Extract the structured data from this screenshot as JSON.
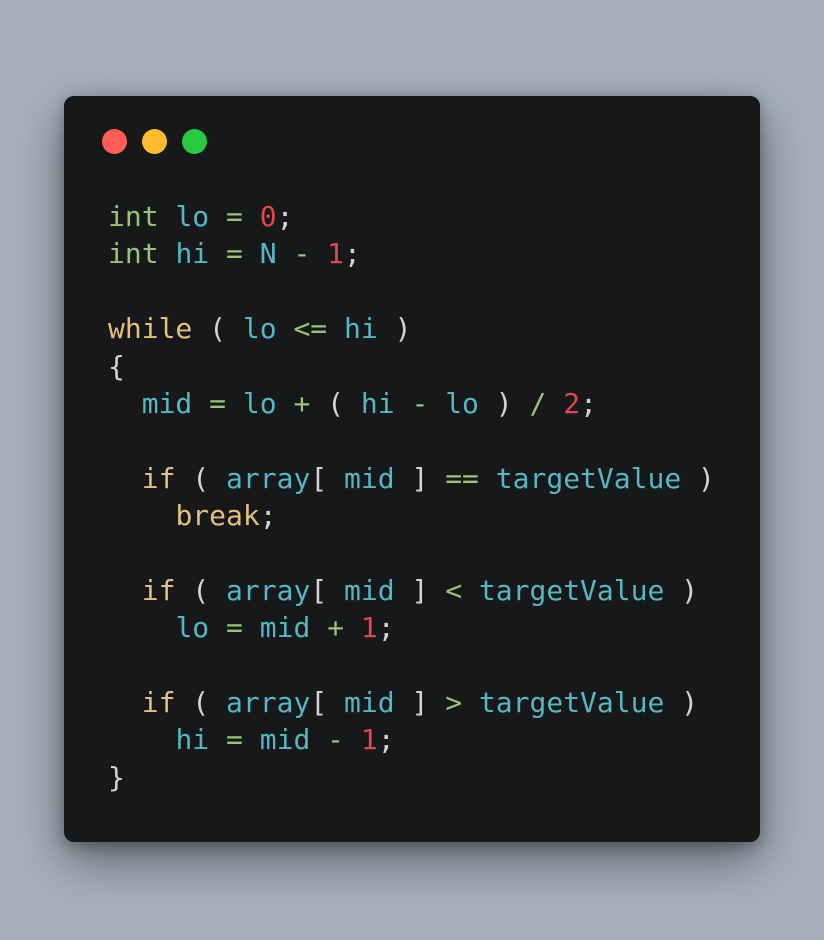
{
  "colors": {
    "background": "#a5b0bc",
    "window": "#17181a",
    "close": "#ff5f57",
    "minimize": "#febc2e",
    "maximize": "#28c840",
    "type": "#98c379",
    "keyword": "#e5c07b",
    "identifier": "#56b6c2",
    "operator": "#98c379",
    "number": "#e0484f",
    "punct": "#d4d4d4"
  },
  "window_controls": [
    {
      "name": "close-button",
      "color": "#ff5f57"
    },
    {
      "name": "minimize-button",
      "color": "#febc2e"
    },
    {
      "name": "maximize-button",
      "color": "#28c840"
    }
  ],
  "code_lines": [
    [
      {
        "t": "int",
        "c": "type"
      },
      {
        "t": " ",
        "c": "punct"
      },
      {
        "t": "lo",
        "c": "identifier"
      },
      {
        "t": " ",
        "c": "punct"
      },
      {
        "t": "=",
        "c": "operator"
      },
      {
        "t": " ",
        "c": "punct"
      },
      {
        "t": "0",
        "c": "number"
      },
      {
        "t": ";",
        "c": "punct"
      }
    ],
    [
      {
        "t": "int",
        "c": "type"
      },
      {
        "t": " ",
        "c": "punct"
      },
      {
        "t": "hi",
        "c": "identifier"
      },
      {
        "t": " ",
        "c": "punct"
      },
      {
        "t": "=",
        "c": "operator"
      },
      {
        "t": " ",
        "c": "punct"
      },
      {
        "t": "N",
        "c": "identifier"
      },
      {
        "t": " ",
        "c": "punct"
      },
      {
        "t": "-",
        "c": "operator"
      },
      {
        "t": " ",
        "c": "punct"
      },
      {
        "t": "1",
        "c": "number"
      },
      {
        "t": ";",
        "c": "punct"
      }
    ],
    [],
    [
      {
        "t": "while",
        "c": "keyword"
      },
      {
        "t": " ( ",
        "c": "punct"
      },
      {
        "t": "lo",
        "c": "identifier"
      },
      {
        "t": " ",
        "c": "punct"
      },
      {
        "t": "<=",
        "c": "operator"
      },
      {
        "t": " ",
        "c": "punct"
      },
      {
        "t": "hi",
        "c": "identifier"
      },
      {
        "t": " )",
        "c": "punct"
      }
    ],
    [
      {
        "t": "{",
        "c": "punct"
      }
    ],
    [
      {
        "t": "  ",
        "c": "punct"
      },
      {
        "t": "mid",
        "c": "identifier"
      },
      {
        "t": " ",
        "c": "punct"
      },
      {
        "t": "=",
        "c": "operator"
      },
      {
        "t": " ",
        "c": "punct"
      },
      {
        "t": "lo",
        "c": "identifier"
      },
      {
        "t": " ",
        "c": "punct"
      },
      {
        "t": "+",
        "c": "operator"
      },
      {
        "t": " ( ",
        "c": "punct"
      },
      {
        "t": "hi",
        "c": "identifier"
      },
      {
        "t": " ",
        "c": "punct"
      },
      {
        "t": "-",
        "c": "operator"
      },
      {
        "t": " ",
        "c": "punct"
      },
      {
        "t": "lo",
        "c": "identifier"
      },
      {
        "t": " ) ",
        "c": "punct"
      },
      {
        "t": "/",
        "c": "operator"
      },
      {
        "t": " ",
        "c": "punct"
      },
      {
        "t": "2",
        "c": "number"
      },
      {
        "t": ";",
        "c": "punct"
      }
    ],
    [],
    [
      {
        "t": "  ",
        "c": "punct"
      },
      {
        "t": "if",
        "c": "keyword"
      },
      {
        "t": " ( ",
        "c": "punct"
      },
      {
        "t": "array",
        "c": "identifier"
      },
      {
        "t": "[ ",
        "c": "punct"
      },
      {
        "t": "mid",
        "c": "identifier"
      },
      {
        "t": " ] ",
        "c": "punct"
      },
      {
        "t": "==",
        "c": "operator"
      },
      {
        "t": " ",
        "c": "punct"
      },
      {
        "t": "targetValue",
        "c": "identifier"
      },
      {
        "t": " )",
        "c": "punct"
      }
    ],
    [
      {
        "t": "    ",
        "c": "punct"
      },
      {
        "t": "break",
        "c": "keyword"
      },
      {
        "t": ";",
        "c": "punct"
      }
    ],
    [],
    [
      {
        "t": "  ",
        "c": "punct"
      },
      {
        "t": "if",
        "c": "keyword"
      },
      {
        "t": " ( ",
        "c": "punct"
      },
      {
        "t": "array",
        "c": "identifier"
      },
      {
        "t": "[ ",
        "c": "punct"
      },
      {
        "t": "mid",
        "c": "identifier"
      },
      {
        "t": " ] ",
        "c": "punct"
      },
      {
        "t": "<",
        "c": "operator"
      },
      {
        "t": " ",
        "c": "punct"
      },
      {
        "t": "targetValue",
        "c": "identifier"
      },
      {
        "t": " )",
        "c": "punct"
      }
    ],
    [
      {
        "t": "    ",
        "c": "punct"
      },
      {
        "t": "lo",
        "c": "identifier"
      },
      {
        "t": " ",
        "c": "punct"
      },
      {
        "t": "=",
        "c": "operator"
      },
      {
        "t": " ",
        "c": "punct"
      },
      {
        "t": "mid",
        "c": "identifier"
      },
      {
        "t": " ",
        "c": "punct"
      },
      {
        "t": "+",
        "c": "operator"
      },
      {
        "t": " ",
        "c": "punct"
      },
      {
        "t": "1",
        "c": "number"
      },
      {
        "t": ";",
        "c": "punct"
      }
    ],
    [],
    [
      {
        "t": "  ",
        "c": "punct"
      },
      {
        "t": "if",
        "c": "keyword"
      },
      {
        "t": " ( ",
        "c": "punct"
      },
      {
        "t": "array",
        "c": "identifier"
      },
      {
        "t": "[ ",
        "c": "punct"
      },
      {
        "t": "mid",
        "c": "identifier"
      },
      {
        "t": " ] ",
        "c": "punct"
      },
      {
        "t": ">",
        "c": "operator"
      },
      {
        "t": " ",
        "c": "punct"
      },
      {
        "t": "targetValue",
        "c": "identifier"
      },
      {
        "t": " )",
        "c": "punct"
      }
    ],
    [
      {
        "t": "    ",
        "c": "punct"
      },
      {
        "t": "hi",
        "c": "identifier"
      },
      {
        "t": " ",
        "c": "punct"
      },
      {
        "t": "=",
        "c": "operator"
      },
      {
        "t": " ",
        "c": "punct"
      },
      {
        "t": "mid",
        "c": "identifier"
      },
      {
        "t": " ",
        "c": "punct"
      },
      {
        "t": "-",
        "c": "operator"
      },
      {
        "t": " ",
        "c": "punct"
      },
      {
        "t": "1",
        "c": "number"
      },
      {
        "t": ";",
        "c": "punct"
      }
    ],
    [
      {
        "t": "}",
        "c": "punct"
      }
    ]
  ]
}
